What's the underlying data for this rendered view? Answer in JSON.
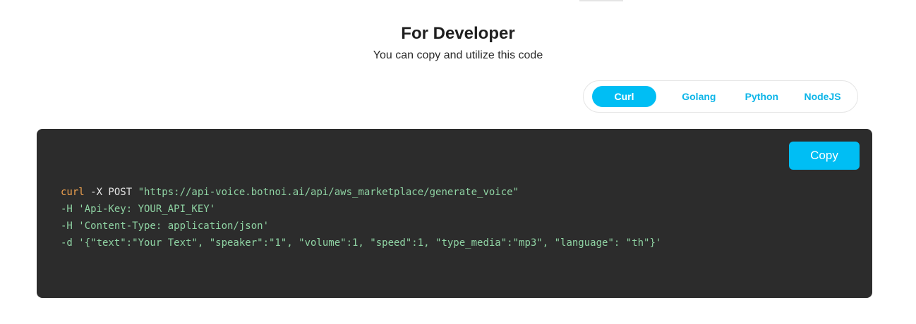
{
  "header": {
    "title": "For Developer",
    "subtitle": "You can copy and utilize this code"
  },
  "tabs": [
    {
      "label": "Curl",
      "active": true
    },
    {
      "label": "Golang",
      "active": false
    },
    {
      "label": "Python",
      "active": false
    },
    {
      "label": "NodeJS",
      "active": false
    }
  ],
  "code_panel": {
    "copy_label": "Copy",
    "lines": {
      "l1": {
        "cmd": "curl",
        "flag": " -X POST ",
        "url": "\"https://api-voice.botnoi.ai/api/aws_marketplace/generate_voice\""
      },
      "l2": "-H 'Api-Key: YOUR_API_KEY'",
      "l3": "-H 'Content-Type: application/json'",
      "l4": "-d '{\"text\":\"Your Text\", \"speaker\":\"1\", \"volume\":1, \"speed\":1, \"type_media\":\"mp3\", \"language\": \"th\"}'"
    }
  },
  "colors": {
    "accent": "#00bef4",
    "code_background": "#2c2c2c",
    "code_command": "#f0a24f",
    "code_string": "#8fd3a3"
  }
}
